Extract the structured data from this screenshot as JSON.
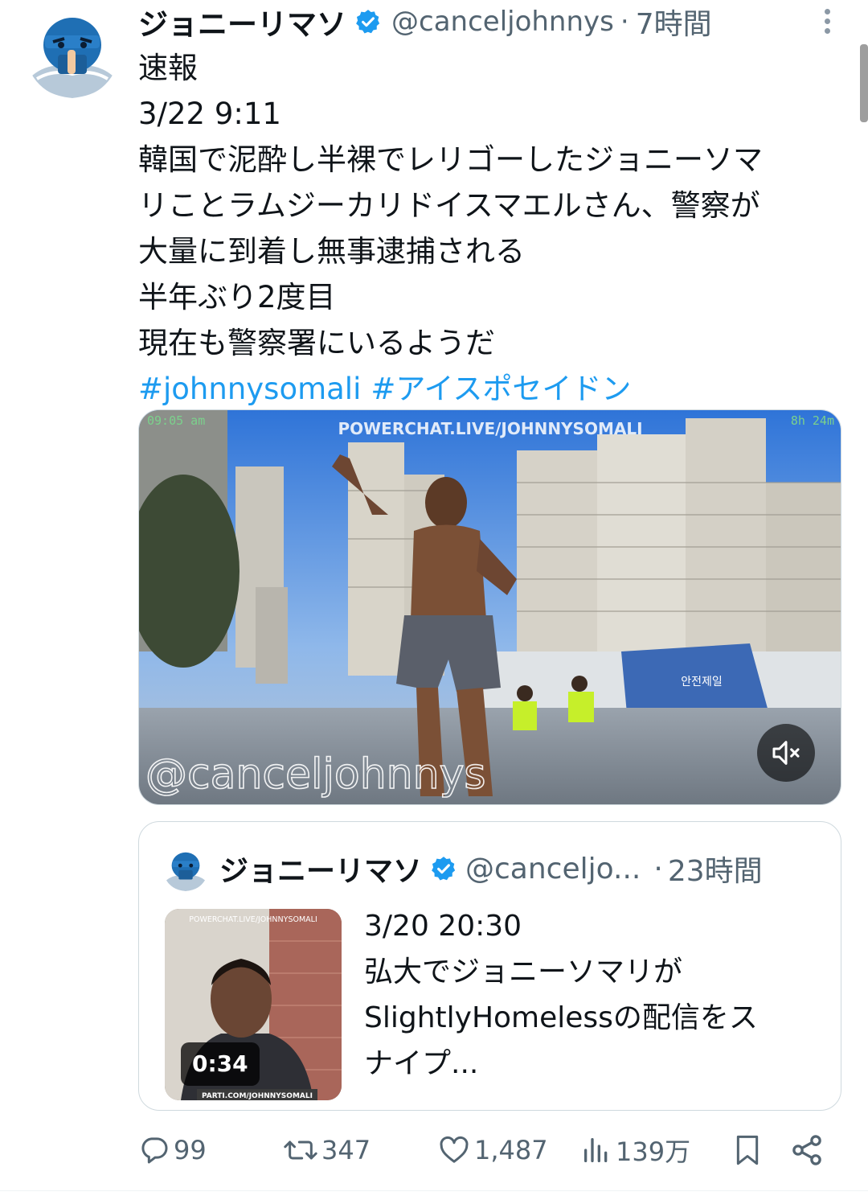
{
  "tweet": {
    "author_name": "ジョニーリマソ",
    "author_handle": "@canceljohnnys",
    "separator": "·",
    "time": "7時間",
    "body_lines": [
      "速報",
      "3/22 9:11",
      "韓国で泥酔し半裸でレリゴーしたジョニーソマ",
      "リことラムジーカリドイスマエルさん、警察が",
      "大量に到着し無事逮捕される",
      "半年ぶり2度目",
      "現在も警察署にいるようだ"
    ],
    "hashtags": [
      "#johnnysomali",
      "#アイスポセイドン"
    ]
  },
  "media": {
    "overlay_top_center": "POWERCHAT.LIVE/JOHNNYSOMALI",
    "overlay_top_left": "09:05 am",
    "overlay_top_right": "8h 24m",
    "watermark": "@canceljohnnys",
    "barrier_sign": "안전제일",
    "mute_icon": "speaker-muted-icon"
  },
  "quote": {
    "author_name": "ジョニーリマソ",
    "author_handle": "@canceljo...",
    "separator": "·",
    "time": "23時間",
    "thumb_top_text": "POWERCHAT.LIVE/JOHNNYSOMALI",
    "thumb_bottom_text": "PARTI.COM/JOHNNYSOMALI",
    "duration": "0:34",
    "text_lines": [
      "3/20 20:30",
      "弘大でジョニーソマリが",
      "SlightlyHomelessの配信をス",
      "ナイプ..."
    ]
  },
  "actions": {
    "replies": "99",
    "retweets": "347",
    "likes": "1,487",
    "views": "139万"
  },
  "colors": {
    "link": "#1d9bf0",
    "secondary_text": "#536471",
    "verified": "#1d9bf0"
  }
}
